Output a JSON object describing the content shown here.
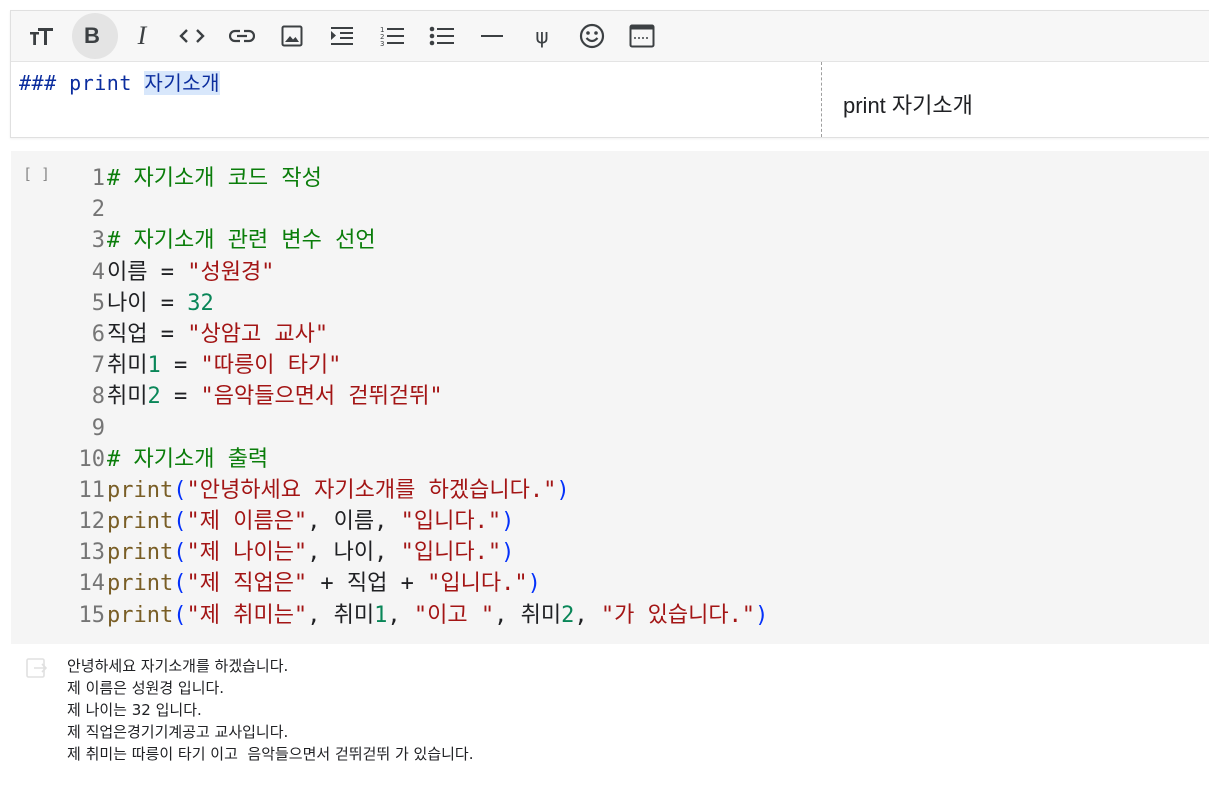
{
  "toolbar": {
    "buttons": [
      {
        "name": "text-size-button",
        "icon": "text-size-icon"
      },
      {
        "name": "bold-button",
        "icon": "bold-icon"
      },
      {
        "name": "italic-button",
        "icon": "italic-icon"
      },
      {
        "name": "code-button",
        "icon": "code-icon"
      },
      {
        "name": "link-button",
        "icon": "link-icon"
      },
      {
        "name": "image-button",
        "icon": "image-icon"
      },
      {
        "name": "indent-button",
        "icon": "indent-icon"
      },
      {
        "name": "numbered-list-button",
        "icon": "numbered-list-icon"
      },
      {
        "name": "bulleted-list-button",
        "icon": "bulleted-list-icon"
      },
      {
        "name": "horizontal-rule-button",
        "icon": "horizontal-rule-icon"
      },
      {
        "name": "latex-button",
        "icon": "psi-icon"
      },
      {
        "name": "emoji-button",
        "icon": "emoji-icon"
      },
      {
        "name": "preview-layout-button",
        "icon": "preview-layout-icon"
      }
    ],
    "active_button": "bold-button",
    "bold_glyph": "B",
    "italic_glyph": "I",
    "text_size_glyph": "тT",
    "code_glyph": "<>",
    "psi_glyph": "ψ"
  },
  "text_cell": {
    "editor_prefix": "### print ",
    "editor_highlight": "자기소개",
    "preview_text": "print 자기소개"
  },
  "code_cell": {
    "run_label": "[ ]",
    "lines": [
      {
        "n": "1",
        "tokens": [
          {
            "t": "# 자기소개 코드 작성",
            "k": "com"
          }
        ]
      },
      {
        "n": "2",
        "tokens": []
      },
      {
        "n": "3",
        "tokens": [
          {
            "t": "# 자기소개 관련 변수 선언",
            "k": "com"
          }
        ]
      },
      {
        "n": "4",
        "tokens": [
          {
            "t": "이름 = ",
            "k": "var"
          },
          {
            "t": "\"성원경\"",
            "k": "str"
          }
        ]
      },
      {
        "n": "5",
        "tokens": [
          {
            "t": "나이 = ",
            "k": "var"
          },
          {
            "t": "32",
            "k": "num"
          }
        ]
      },
      {
        "n": "6",
        "tokens": [
          {
            "t": "직업 = ",
            "k": "var"
          },
          {
            "t": "\"상암고 교사\"",
            "k": "str"
          }
        ]
      },
      {
        "n": "7",
        "tokens": [
          {
            "t": "취미",
            "k": "var"
          },
          {
            "t": "1",
            "k": "num"
          },
          {
            "t": " = ",
            "k": "var"
          },
          {
            "t": "\"따릉이 타기\"",
            "k": "str"
          }
        ]
      },
      {
        "n": "8",
        "tokens": [
          {
            "t": "취미",
            "k": "var"
          },
          {
            "t": "2",
            "k": "num"
          },
          {
            "t": " = ",
            "k": "var"
          },
          {
            "t": "\"음악들으면서 걷뛰걷뛰\"",
            "k": "str"
          }
        ]
      },
      {
        "n": "9",
        "tokens": []
      },
      {
        "n": "10",
        "tokens": [
          {
            "t": "# 자기소개 출력",
            "k": "com"
          }
        ]
      },
      {
        "n": "11",
        "tokens": [
          {
            "t": "print",
            "k": "fn"
          },
          {
            "t": "(",
            "k": "par"
          },
          {
            "t": "\"안녕하세요 자기소개를 하겠습니다.\"",
            "k": "str"
          },
          {
            "t": ")",
            "k": "par"
          }
        ]
      },
      {
        "n": "12",
        "tokens": [
          {
            "t": "print",
            "k": "fn"
          },
          {
            "t": "(",
            "k": "par"
          },
          {
            "t": "\"제 이름은\"",
            "k": "str"
          },
          {
            "t": ", 이름, ",
            "k": "var"
          },
          {
            "t": "\"입니다.\"",
            "k": "str"
          },
          {
            "t": ")",
            "k": "par"
          }
        ]
      },
      {
        "n": "13",
        "tokens": [
          {
            "t": "print",
            "k": "fn"
          },
          {
            "t": "(",
            "k": "par"
          },
          {
            "t": "\"제 나이는\"",
            "k": "str"
          },
          {
            "t": ", 나이, ",
            "k": "var"
          },
          {
            "t": "\"입니다.\"",
            "k": "str"
          },
          {
            "t": ")",
            "k": "par"
          }
        ]
      },
      {
        "n": "14",
        "tokens": [
          {
            "t": "print",
            "k": "fn"
          },
          {
            "t": "(",
            "k": "par"
          },
          {
            "t": "\"제 직업은\"",
            "k": "str"
          },
          {
            "t": " + 직업 + ",
            "k": "var"
          },
          {
            "t": "\"입니다.\"",
            "k": "str"
          },
          {
            "t": ")",
            "k": "par"
          }
        ]
      },
      {
        "n": "15",
        "tokens": [
          {
            "t": "print",
            "k": "fn"
          },
          {
            "t": "(",
            "k": "par"
          },
          {
            "t": "\"제 취미는\"",
            "k": "str"
          },
          {
            "t": ", 취미",
            "k": "var"
          },
          {
            "t": "1",
            "k": "num"
          },
          {
            "t": ", ",
            "k": "var"
          },
          {
            "t": "\"이고 \"",
            "k": "str"
          },
          {
            "t": ", 취미",
            "k": "var"
          },
          {
            "t": "2",
            "k": "num"
          },
          {
            "t": ", ",
            "k": "var"
          },
          {
            "t": "\"가 있습니다.\"",
            "k": "str"
          },
          {
            "t": ")",
            "k": "par"
          }
        ]
      }
    ]
  },
  "output": {
    "icon": "output-clear-icon",
    "lines": [
      "안녕하세요 자기소개를 하겠습니다.",
      "제 이름은 성원경 입니다.",
      "제 나이는 32 입니다.",
      "제 직업은경기기계공고 교사입니다.",
      "제 취미는 따릉이 타기 이고  음악들으면서 걷뛰걷뛰 가 있습니다."
    ]
  },
  "colors": {
    "comment": "#0a7d0a",
    "string": "#a31515",
    "number": "#098658",
    "function": "#795e26",
    "paren": "#0431fa",
    "markdown": "#0b2d9e",
    "highlight": "#d8e7fb"
  }
}
